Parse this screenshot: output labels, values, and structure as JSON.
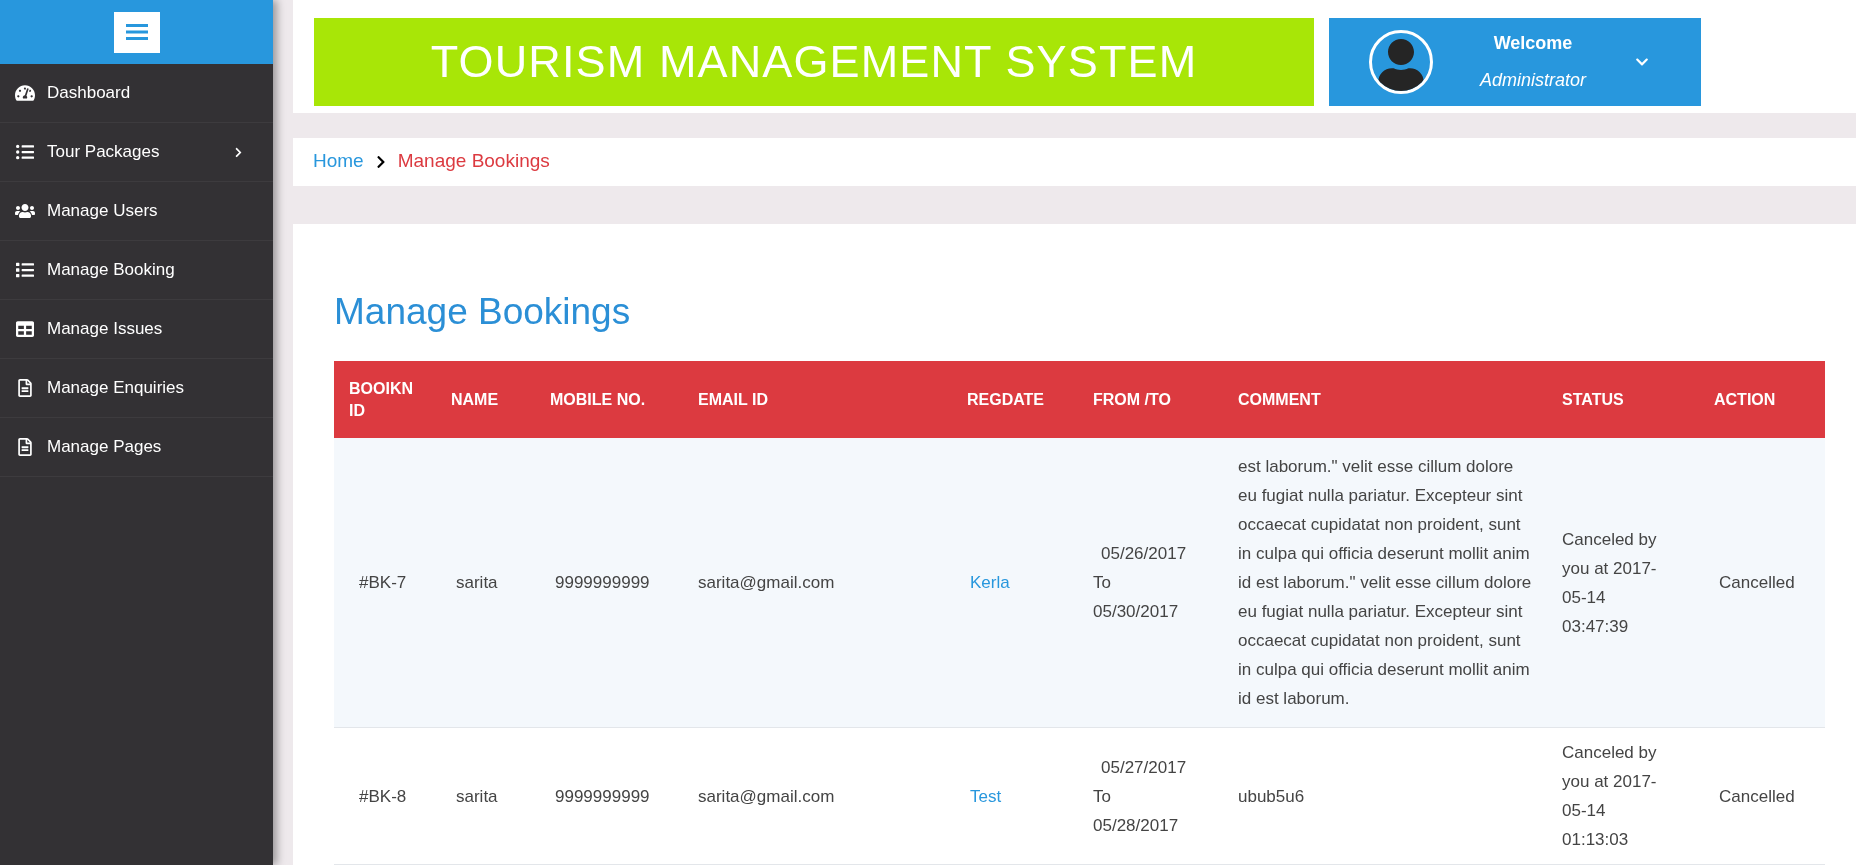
{
  "sidebar": {
    "items": [
      {
        "label": "Dashboard",
        "has_submenu": false
      },
      {
        "label": "Tour Packages",
        "has_submenu": true
      },
      {
        "label": "Manage Users",
        "has_submenu": false
      },
      {
        "label": "Manage Booking",
        "has_submenu": false
      },
      {
        "label": "Manage Issues",
        "has_submenu": false
      },
      {
        "label": "Manage Enquiries",
        "has_submenu": false
      },
      {
        "label": "Manage Pages",
        "has_submenu": false
      }
    ]
  },
  "header": {
    "title": "TOURISM MANAGEMENT SYSTEM",
    "user": {
      "greeting": "Welcome",
      "role": "Administrator"
    }
  },
  "breadcrumb": [
    {
      "label": "Home",
      "current": false
    },
    {
      "label": "Manage Bookings",
      "current": true
    }
  ],
  "page_title": "Manage Bookings",
  "table": {
    "columns": [
      "BOOIKN ID",
      "NAME",
      "MOBILE NO.",
      "EMAIL ID",
      "REGDATE",
      "FROM /TO",
      "COMMENT",
      "STATUS",
      "ACTION"
    ],
    "rows": [
      {
        "id": "#BK-7",
        "name": "sarita",
        "mobile": "9999999999",
        "email": "sarita@gmail.com",
        "regdate": "Kerla",
        "from": "05/26/2017",
        "to_word": "To",
        "to": "05/30/2017",
        "comment": "est laborum.\" velit esse cillum dolore eu fugiat nulla pariatur. Excepteur sint occaecat cupidatat non proident, sunt in culpa qui officia deserunt mollit anim id est laborum.\" velit esse cillum dolore eu fugiat nulla pariatur. Excepteur sint occaecat cupidatat non proident, sunt in culpa qui officia deserunt mollit anim id est laborum.",
        "status": "Canceled by you at 2017-05-14 03:47:39",
        "action": "Cancelled"
      },
      {
        "id": "#BK-8",
        "name": "sarita",
        "mobile": "9999999999",
        "email": "sarita@gmail.com",
        "regdate": "Test",
        "from": "05/27/2017",
        "to_word": "To",
        "to": "05/28/2017",
        "comment": "ubub5u6",
        "status": "Canceled by you at 2017-05-14 01:13:03",
        "action": "Cancelled"
      }
    ]
  }
}
